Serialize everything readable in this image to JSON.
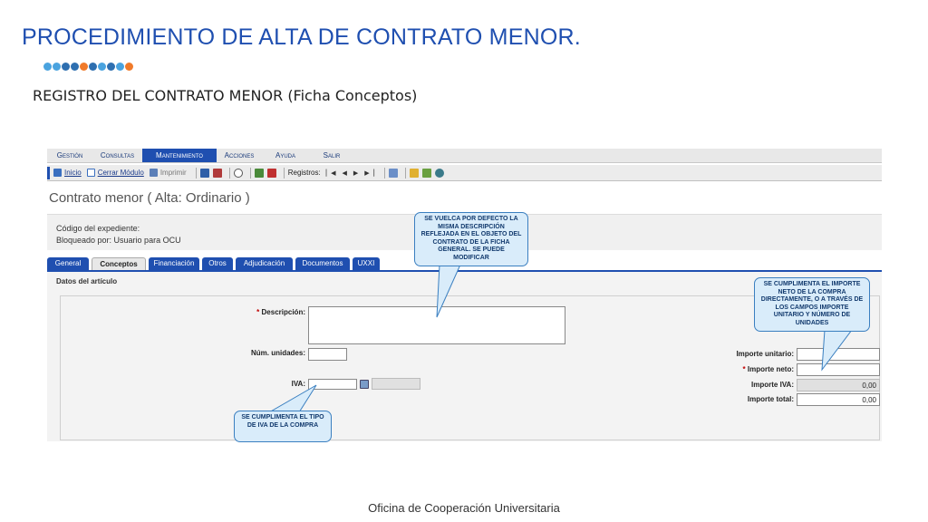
{
  "slide": {
    "title": "PROCEDIMIENTO DE ALTA DE CONTRATO MENOR.",
    "subtitle": "REGISTRO DEL CONTRATO MENOR (Ficha Conceptos)",
    "footer": "Oficina de Cooperación Universitaria",
    "dot_colors": [
      "#4aa3df",
      "#4aa3df",
      "#2e6fb0",
      "#2e6fb0",
      "#f07a2a",
      "#2e6fb0",
      "#4aa3df",
      "#2e6fb0",
      "#4aa3df",
      "#f07a2a"
    ]
  },
  "app": {
    "menu": [
      {
        "label": "Gestión",
        "active": false
      },
      {
        "label": "Consultas",
        "active": false
      },
      {
        "label": "Mantenimiento",
        "active": true
      },
      {
        "label": "Acciones",
        "active": false
      },
      {
        "label": "Ayuda",
        "active": false
      },
      {
        "label": "Salir",
        "active": false
      }
    ],
    "toolbar": {
      "inicio": "Inicio",
      "cerrar_modulo": "Cerrar Módulo",
      "imprimir": "Imprimir",
      "registros": "Registros:"
    },
    "form_title": "Contrato menor ( Alta: Ordinario )",
    "info": {
      "codigo": "Código del expediente:",
      "bloqueado": "Bloqueado por: Usuario para OCU"
    },
    "tabs": [
      {
        "label": "General",
        "active": false
      },
      {
        "label": "Conceptos",
        "active": true
      },
      {
        "label": "Financiación",
        "active": false
      },
      {
        "label": "Otros",
        "active": false
      },
      {
        "label": "Adjudicación",
        "active": false
      },
      {
        "label": "Documentos",
        "active": false
      },
      {
        "label": "UXXI",
        "active": false
      }
    ],
    "panel": {
      "heading": "Datos del artículo",
      "descripcion": "Descripción:",
      "required_mark": "*",
      "num_unidades": "Núm. unidades:",
      "iva": "IVA:",
      "importe_unitario": "Importe unitario:",
      "importe_neto": "Importe neto:",
      "importe_iva": "Importe IVA:",
      "importe_total": "Importe total:",
      "importe_iva_value": "0,00",
      "importe_total_value": "0,00"
    }
  },
  "callouts": {
    "descripcion_note": "SE VUELCA POR DEFECTO LA MISMA DESCRIPCIÓN REFLEJADA EN EL OBJETO DEL CONTRATO DE LA FICHA GENERAL. SE PUEDE MODIFICAR",
    "neto_note": "SE CUMPLIMENTA EL IMPORTE NETO DE LA COMPRA DIRECTAMENTE, O A TRAVÉS DE LOS CAMPOS IMPORTE UNITARIO Y NÚMERO DE UNIDADES",
    "iva_note": "SE CUMPLIMENTA EL TIPO DE IVA DE LA COMPRA"
  }
}
